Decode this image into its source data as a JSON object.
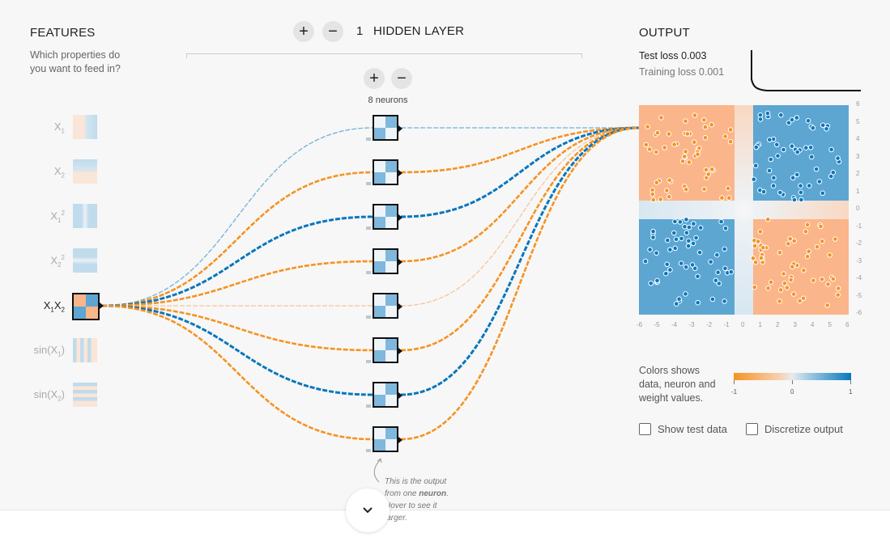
{
  "features": {
    "title": "FEATURES",
    "subtitle_line1": "Which properties do",
    "subtitle_line2": "you want to feed in?",
    "items": [
      {
        "base": "X",
        "sub": "1",
        "sup": "",
        "tail": "",
        "active": false
      },
      {
        "base": "X",
        "sub": "2",
        "sup": "",
        "tail": "",
        "active": false
      },
      {
        "base": "X",
        "sub": "1",
        "sup": "2",
        "tail": "",
        "active": false
      },
      {
        "base": "X",
        "sub": "2",
        "sup": "2",
        "tail": "",
        "active": false
      },
      {
        "base": "X",
        "sub": "1",
        "sup": "",
        "tail": "X2",
        "active": true
      },
      {
        "base": "sin(X",
        "sub": "1",
        "sup": "",
        "tail": ")",
        "active": false
      },
      {
        "base": "sin(X",
        "sub": "2",
        "sup": "",
        "tail": ")",
        "active": false
      }
    ]
  },
  "hidden": {
    "layer_count": "1",
    "layer_label": "HIDDEN LAYER",
    "neuron_count_label": "8 neurons",
    "plus": "+",
    "minus": "−"
  },
  "hint": {
    "line1": "This is the output",
    "line2_prefix": "from one ",
    "line2_bold": "neuron",
    "line2_suffix": ".",
    "line3": "Hover to see it",
    "line4": "larger."
  },
  "output": {
    "title": "OUTPUT",
    "test_loss_label": "Test loss",
    "test_loss": "0.003",
    "training_loss_label": "Training loss",
    "training_loss": "0.001",
    "x_ticks": [
      "-6",
      "-5",
      "-4",
      "-3",
      "-2",
      "-1",
      "0",
      "1",
      "2",
      "3",
      "4",
      "5",
      "6"
    ],
    "y_ticks": [
      "6",
      "5",
      "4",
      "3",
      "2",
      "1",
      "0",
      "-1",
      "-2",
      "-3",
      "-4",
      "-5",
      "-6"
    ],
    "legend_line1": "Colors shows",
    "legend_line2": "data, neuron and",
    "legend_line3": "weight values.",
    "scale_min": "-1",
    "scale_mid": "0",
    "scale_max": "1",
    "show_test_data": "Show test data",
    "discretize_output": "Discretize output"
  },
  "colors": {
    "orange": "#f59322",
    "blue": "#0877bd",
    "light_blue": "#6fb3d9",
    "light_orange": "#f7c49a"
  },
  "weights": [
    {
      "in": "light_blue",
      "out": "light_blue"
    },
    {
      "in": "orange",
      "out": "orange"
    },
    {
      "in": "blue",
      "out": "blue"
    },
    {
      "in": "orange",
      "out": "orange"
    },
    {
      "in": "light_orange",
      "out": "light_orange"
    },
    {
      "in": "orange",
      "out": "orange"
    },
    {
      "in": "blue",
      "out": "blue"
    },
    {
      "in": "orange",
      "out": "orange"
    }
  ]
}
